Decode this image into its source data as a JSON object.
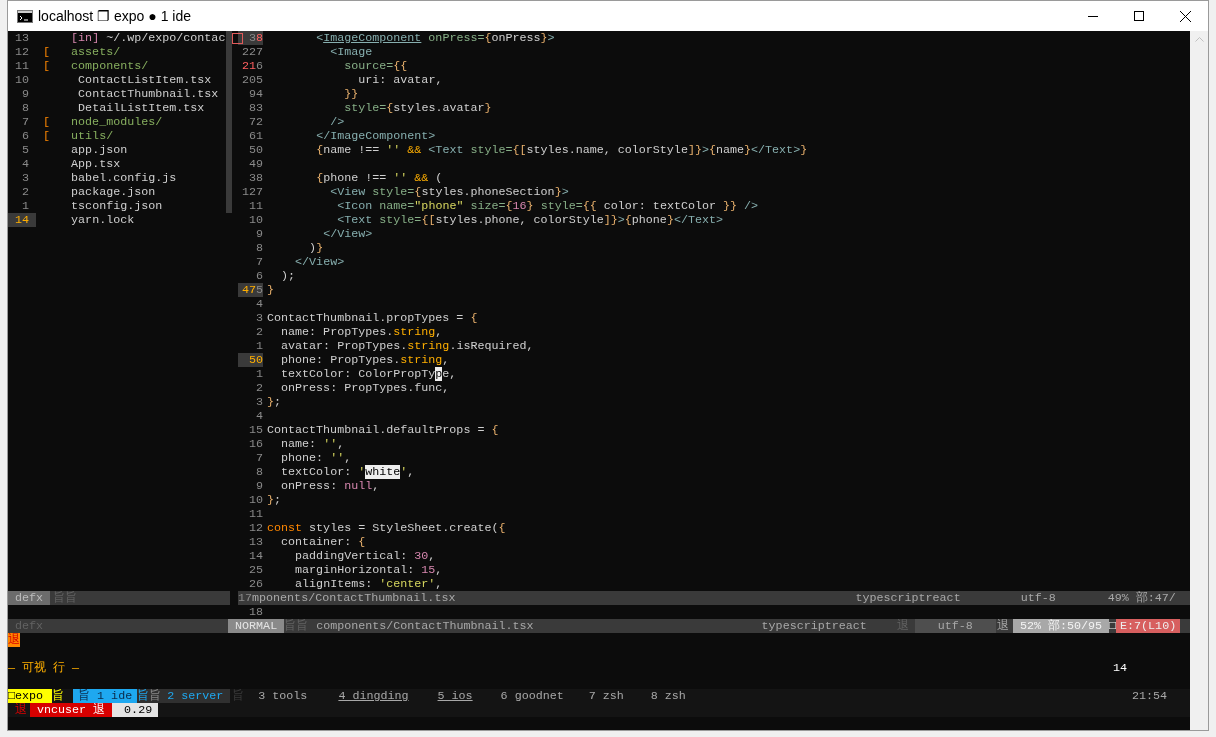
{
  "window": {
    "title": "localhost ❐ expo ● 1 ide"
  },
  "tree_pane": {
    "rows": [
      {
        "num": [
          {
            "text": "13",
            "kind": "d"
          }
        ],
        "hl": false,
        "text": [
          {
            "text": "     [in]",
            "kind": "m"
          },
          {
            "text": " ~/.wp/expo/contac",
            "kind": "p"
          }
        ]
      },
      {
        "num": [
          {
            "text": "12",
            "kind": "d"
          }
        ],
        "hl": false,
        "text": [
          {
            "text": " [",
            "kind": "br"
          },
          {
            "text": "   assets/",
            "kind": "g"
          }
        ]
      },
      {
        "num": [
          {
            "text": "11",
            "kind": "d"
          }
        ],
        "hl": false,
        "text": [
          {
            "text": " [",
            "kind": "br"
          },
          {
            "text": "   components/",
            "kind": "g"
          }
        ]
      },
      {
        "num": [
          {
            "text": "10",
            "kind": "d"
          }
        ],
        "hl": false,
        "text": [
          {
            "text": "      ContactListItem.tsx",
            "kind": "p"
          }
        ]
      },
      {
        "num": [
          {
            "text": "9",
            "kind": "d"
          }
        ],
        "hl": false,
        "text": [
          {
            "text": "      ContactThumbnail.tsx",
            "kind": "p"
          }
        ]
      },
      {
        "num": [
          {
            "text": "8",
            "kind": "d"
          }
        ],
        "hl": false,
        "text": [
          {
            "text": "      DetailListItem.tsx",
            "kind": "p"
          }
        ]
      },
      {
        "num": [
          {
            "text": "7",
            "kind": "d"
          }
        ],
        "hl": false,
        "text": [
          {
            "text": " [",
            "kind": "br"
          },
          {
            "text": "   node_modules/",
            "kind": "g"
          }
        ]
      },
      {
        "num": [
          {
            "text": "6",
            "kind": "d"
          }
        ],
        "hl": false,
        "text": [
          {
            "text": " [",
            "kind": "br"
          },
          {
            "text": "   utils/",
            "kind": "g"
          }
        ]
      },
      {
        "num": [
          {
            "text": "5",
            "kind": "d"
          }
        ],
        "hl": false,
        "text": [
          {
            "text": "     app.json",
            "kind": "p"
          }
        ]
      },
      {
        "num": [
          {
            "text": "4",
            "kind": "d"
          }
        ],
        "hl": false,
        "text": [
          {
            "text": "     App.tsx",
            "kind": "p"
          }
        ]
      },
      {
        "num": [
          {
            "text": "3",
            "kind": "d"
          }
        ],
        "hl": false,
        "text": [
          {
            "text": "     babel.config.js",
            "kind": "p"
          }
        ]
      },
      {
        "num": [
          {
            "text": "2",
            "kind": "d"
          }
        ],
        "hl": false,
        "text": [
          {
            "text": "     package.json",
            "kind": "p"
          }
        ]
      },
      {
        "num": [
          {
            "text": "1",
            "kind": "d"
          }
        ],
        "hl": false,
        "text": [
          {
            "text": "     tsconfig.json",
            "kind": "p"
          }
        ]
      },
      {
        "num": [
          {
            "text": "14",
            "kind": "o"
          }
        ],
        "hl": true,
        "text": [
          {
            "text": "     yarn.lock",
            "kind": "p"
          }
        ]
      }
    ]
  },
  "editor_pane": {
    "rows": [
      {
        "num": [
          {
            "text": "3",
            "kind": "d"
          },
          {
            "text": "8",
            "kind": "r"
          }
        ],
        "hl": true,
        "sign": true,
        "code": [
          {
            "text": "       <",
            "kind": "t"
          },
          {
            "text": "ImageComponent",
            "kind": "tu"
          },
          {
            "text": " onPress=",
            "kind": "a"
          },
          {
            "text": "{",
            "kind": "b"
          },
          {
            "text": "onPress",
            "kind": "p"
          },
          {
            "text": "}",
            "kind": "b"
          },
          {
            "text": ">",
            "kind": "t"
          }
        ]
      },
      {
        "num": [
          {
            "text": "227",
            "kind": "d"
          }
        ],
        "hl": false,
        "code": [
          {
            "text": "         <Image",
            "kind": "t"
          }
        ]
      },
      {
        "num": [
          {
            "text": "21",
            "kind": "r"
          },
          {
            "text": "6",
            "kind": "d"
          }
        ],
        "hl": false,
        "code": [
          {
            "text": "           source=",
            "kind": "a"
          },
          {
            "text": "{{",
            "kind": "b"
          }
        ]
      },
      {
        "num": [
          {
            "text": "205",
            "kind": "d"
          }
        ],
        "hl": false,
        "code": [
          {
            "text": "             uri: avatar,",
            "kind": "p"
          }
        ]
      },
      {
        "num": [
          {
            "text": "94",
            "kind": "d"
          }
        ],
        "hl": false,
        "code": [
          {
            "text": "           }}",
            "kind": "b"
          }
        ]
      },
      {
        "num": [
          {
            "text": "83",
            "kind": "d"
          }
        ],
        "hl": false,
        "code": [
          {
            "text": "           style=",
            "kind": "a"
          },
          {
            "text": "{",
            "kind": "b"
          },
          {
            "text": "styles.avatar",
            "kind": "p"
          },
          {
            "text": "}",
            "kind": "b"
          }
        ]
      },
      {
        "num": [
          {
            "text": "72",
            "kind": "d"
          }
        ],
        "hl": false,
        "code": [
          {
            "text": "         />",
            "kind": "t"
          }
        ]
      },
      {
        "num": [
          {
            "text": "61",
            "kind": "d"
          }
        ],
        "hl": false,
        "code": [
          {
            "text": "       </ImageComponent>",
            "kind": "t"
          }
        ]
      },
      {
        "num": [
          {
            "text": "50",
            "kind": "d"
          }
        ],
        "hl": false,
        "code": [
          {
            "text": "       {",
            "kind": "b"
          },
          {
            "text": "name !== ",
            "kind": "p"
          },
          {
            "text": "''",
            "kind": "s"
          },
          {
            "text": " &&",
            "kind": "o"
          },
          {
            "text": " <Text",
            "kind": "t"
          },
          {
            "text": " style=",
            "kind": "a"
          },
          {
            "text": "{[",
            "kind": "b"
          },
          {
            "text": "styles.name, colorStyle",
            "kind": "p"
          },
          {
            "text": "]}",
            "kind": "b"
          },
          {
            "text": ">",
            "kind": "t"
          },
          {
            "text": "{",
            "kind": "b"
          },
          {
            "text": "name",
            "kind": "p"
          },
          {
            "text": "}",
            "kind": "b"
          },
          {
            "text": "</Text>",
            "kind": "t"
          },
          {
            "text": "}",
            "kind": "b"
          }
        ]
      },
      {
        "num": [
          {
            "text": "49",
            "kind": "d"
          }
        ],
        "hl": false
      },
      {
        "num": [
          {
            "text": "38",
            "kind": "d"
          }
        ],
        "hl": false,
        "code": [
          {
            "text": "       {",
            "kind": "b"
          },
          {
            "text": "phone !== ",
            "kind": "p"
          },
          {
            "text": "''",
            "kind": "s"
          },
          {
            "text": " &&",
            "kind": "o"
          },
          {
            "text": " (",
            "kind": "p"
          }
        ]
      },
      {
        "num": [
          {
            "text": "127",
            "kind": "d"
          }
        ],
        "hl": false,
        "code": [
          {
            "text": "         <View",
            "kind": "t"
          },
          {
            "text": " style=",
            "kind": "a"
          },
          {
            "text": "{",
            "kind": "b"
          },
          {
            "text": "styles.phoneSection",
            "kind": "p"
          },
          {
            "text": "}",
            "kind": "b"
          },
          {
            "text": ">",
            "kind": "t"
          }
        ]
      },
      {
        "num": [
          {
            "text": "11",
            "kind": "d"
          }
        ],
        "hl": false,
        "code": [
          {
            "text": "          <Icon",
            "kind": "t"
          },
          {
            "text": " name=",
            "kind": "a"
          },
          {
            "text": "\"phone\"",
            "kind": "s"
          },
          {
            "text": " size=",
            "kind": "a"
          },
          {
            "text": "{",
            "kind": "b"
          },
          {
            "text": "16",
            "kind": "n"
          },
          {
            "text": "}",
            "kind": "b"
          },
          {
            "text": " style=",
            "kind": "a"
          },
          {
            "text": "{{",
            "kind": "b"
          },
          {
            "text": " color: textColor ",
            "kind": "p"
          },
          {
            "text": "}}",
            "kind": "b"
          },
          {
            "text": " />",
            "kind": "t"
          }
        ]
      },
      {
        "num": [
          {
            "text": "10",
            "kind": "d"
          }
        ],
        "hl": false,
        "code": [
          {
            "text": "          <Text",
            "kind": "t"
          },
          {
            "text": " style=",
            "kind": "a"
          },
          {
            "text": "{[",
            "kind": "b"
          },
          {
            "text": "styles.phone, colorStyle",
            "kind": "p"
          },
          {
            "text": "]}",
            "kind": "b"
          },
          {
            "text": ">",
            "kind": "t"
          },
          {
            "text": "{",
            "kind": "b"
          },
          {
            "text": "phone",
            "kind": "p"
          },
          {
            "text": "}",
            "kind": "b"
          },
          {
            "text": "</Text>",
            "kind": "t"
          }
        ]
      },
      {
        "num": [
          {
            "text": "9",
            "kind": "d"
          }
        ],
        "hl": false,
        "code": [
          {
            "text": "        </View>",
            "kind": "t"
          }
        ]
      },
      {
        "num": [
          {
            "text": "8",
            "kind": "d"
          }
        ],
        "hl": false,
        "code": [
          {
            "text": "      )",
            "kind": "p"
          },
          {
            "text": "}",
            "kind": "b"
          }
        ]
      },
      {
        "num": [
          {
            "text": "7",
            "kind": "d"
          }
        ],
        "hl": false,
        "code": [
          {
            "text": "    </View>",
            "kind": "t"
          }
        ]
      },
      {
        "num": [
          {
            "text": "6",
            "kind": "d"
          }
        ],
        "hl": false,
        "code": [
          {
            "text": "  );",
            "kind": "p"
          }
        ]
      },
      {
        "num": [
          {
            "text": "47",
            "kind": "o"
          },
          {
            "text": "5",
            "kind": "d"
          }
        ],
        "hl": true,
        "code": [
          {
            "text": "}",
            "kind": "b"
          }
        ]
      },
      {
        "num": [
          {
            "text": "4",
            "kind": "d"
          }
        ],
        "hl": false
      },
      {
        "num": [
          {
            "text": "3",
            "kind": "d"
          }
        ],
        "hl": false,
        "code": [
          {
            "text": "ContactThumbnail.propTypes = ",
            "kind": "p"
          },
          {
            "text": "{",
            "kind": "b"
          }
        ]
      },
      {
        "num": [
          {
            "text": "2",
            "kind": "d"
          }
        ],
        "hl": false,
        "code": [
          {
            "text": "  name: PropTypes.",
            "kind": "p"
          },
          {
            "text": "string",
            "kind": "y"
          },
          {
            "text": ",",
            "kind": "p"
          }
        ]
      },
      {
        "num": [
          {
            "text": "1",
            "kind": "d"
          }
        ],
        "hl": false,
        "code": [
          {
            "text": "  avatar: PropTypes.",
            "kind": "p"
          },
          {
            "text": "string",
            "kind": "y"
          },
          {
            "text": ".isRequired,",
            "kind": "p"
          }
        ]
      },
      {
        "num": [
          {
            "text": "50",
            "kind": "o"
          }
        ],
        "hl": true,
        "code": [
          {
            "text": "  phone: PropTypes.",
            "kind": "p"
          },
          {
            "text": "string",
            "kind": "y"
          },
          {
            "text": ",",
            "kind": "p"
          }
        ]
      },
      {
        "num": [
          {
            "text": "1",
            "kind": "d"
          }
        ],
        "hl": false,
        "code": [
          {
            "text": "  textColor: ColorPropTy",
            "kind": "p"
          },
          {
            "text": "p",
            "kind": "cur"
          },
          {
            "text": "e,",
            "kind": "p"
          }
        ]
      },
      {
        "num": [
          {
            "text": "2",
            "kind": "d"
          }
        ],
        "hl": false,
        "code": [
          {
            "text": "  onPress: PropTypes.func,",
            "kind": "p"
          }
        ]
      },
      {
        "num": [
          {
            "text": "3",
            "kind": "d"
          }
        ],
        "hl": false,
        "code": [
          {
            "text": "}",
            "kind": "b"
          },
          {
            "text": ";",
            "kind": "p"
          }
        ]
      },
      {
        "num": [
          {
            "text": "4",
            "kind": "d"
          }
        ],
        "hl": false
      },
      {
        "num": [
          {
            "text": "15",
            "kind": "d"
          }
        ],
        "hl": false,
        "code": [
          {
            "text": "ContactThumbnail.defaultProps = ",
            "kind": "p"
          },
          {
            "text": "{",
            "kind": "b"
          }
        ]
      },
      {
        "num": [
          {
            "text": "16",
            "kind": "d"
          }
        ],
        "hl": false,
        "code": [
          {
            "text": "  name: ",
            "kind": "p"
          },
          {
            "text": "''",
            "kind": "s"
          },
          {
            "text": ",",
            "kind": "p"
          }
        ]
      },
      {
        "num": [
          {
            "text": "7",
            "kind": "d"
          }
        ],
        "hl": false,
        "code": [
          {
            "text": "  phone: ",
            "kind": "p"
          },
          {
            "text": "''",
            "kind": "s"
          },
          {
            "text": ",",
            "kind": "p"
          }
        ]
      },
      {
        "num": [
          {
            "text": "8",
            "kind": "d"
          }
        ],
        "hl": false,
        "code": [
          {
            "text": "  textColor: ",
            "kind": "p"
          },
          {
            "text": "'",
            "kind": "s"
          },
          {
            "text": "white",
            "kind": "hl"
          },
          {
            "text": "'",
            "kind": "s"
          },
          {
            "text": ",",
            "kind": "p"
          }
        ]
      },
      {
        "num": [
          {
            "text": "9",
            "kind": "d"
          }
        ],
        "hl": false,
        "code": [
          {
            "text": "  onPress: ",
            "kind": "p"
          },
          {
            "text": "null",
            "kind": "n"
          },
          {
            "text": ",",
            "kind": "p"
          }
        ]
      },
      {
        "num": [
          {
            "text": "10",
            "kind": "d"
          }
        ],
        "hl": false,
        "code": [
          {
            "text": "}",
            "kind": "b"
          },
          {
            "text": ";",
            "kind": "p"
          }
        ]
      },
      {
        "num": [
          {
            "text": "11",
            "kind": "d"
          }
        ],
        "hl": false
      },
      {
        "num": [
          {
            "text": "12",
            "kind": "d"
          }
        ],
        "hl": false,
        "code": [
          {
            "text": "const",
            "kind": "k"
          },
          {
            "text": " styles = StyleSheet.create(",
            "kind": "p"
          },
          {
            "text": "{",
            "kind": "b"
          }
        ]
      },
      {
        "num": [
          {
            "text": "13",
            "kind": "d"
          }
        ],
        "hl": false,
        "code": [
          {
            "text": "  container: ",
            "kind": "p"
          },
          {
            "text": "{",
            "kind": "b"
          }
        ]
      },
      {
        "num": [
          {
            "text": "14",
            "kind": "d"
          }
        ],
        "hl": false,
        "code": [
          {
            "text": "    paddingVertical: ",
            "kind": "p"
          },
          {
            "text": "30",
            "kind": "n"
          },
          {
            "text": ",",
            "kind": "p"
          }
        ]
      },
      {
        "num": [
          {
            "text": "25",
            "kind": "d"
          }
        ],
        "hl": false,
        "code": [
          {
            "text": "    marginHorizontal: ",
            "kind": "p"
          },
          {
            "text": "15",
            "kind": "n"
          },
          {
            "text": ",",
            "kind": "p"
          }
        ]
      },
      {
        "num": [
          {
            "text": "26",
            "kind": "d"
          }
        ],
        "hl": false,
        "code": [
          {
            "text": "    alignItems: ",
            "kind": "p"
          },
          {
            "text": "'center'",
            "kind": "s"
          },
          {
            "text": ",",
            "kind": "p"
          }
        ]
      }
    ]
  },
  "tree_status": [
    {
      "text": "defx",
      "kind": "label"
    },
    {
      "text": "旨旨",
      "kind": "faint"
    }
  ],
  "editor_status": [
    {
      "text": "17",
      "kind": "num"
    },
    {
      "text": "mponents/ContactThumbnail.tsx",
      "kind": "text"
    },
    {
      "text": "typescriptreact",
      "kind": "text"
    },
    {
      "text": "utf-8",
      "kind": "text"
    },
    {
      "text": "49% 部:47/",
      "kind": "text"
    }
  ],
  "editor_extra_line": {
    "num": "18"
  },
  "status_line": [
    {
      "text": "defx",
      "kind": "faint"
    },
    {
      "text": "NORMAL",
      "kind": "mode"
    },
    {
      "text": "旨旨",
      "kind": "faint"
    },
    {
      "text": "components/ContactThumbnail.tsx",
      "kind": "text"
    },
    {
      "text": "typescriptreact",
      "kind": "text"
    },
    {
      "text": "退",
      "kind": "faint"
    },
    {
      "text": "utf-8",
      "kind": "panel"
    },
    {
      "text": "退",
      "kind": "text"
    },
    {
      "text": "52% 部:50/95",
      "kind": "light"
    },
    {
      "text": "□",
      "kind": "box"
    },
    {
      "text": "E:7(L10)",
      "kind": "error"
    }
  ],
  "message_line": {
    "text": "退"
  },
  "mode_line": {
    "text": "— 可视 行 —",
    "count": "14"
  },
  "tmux_bar": {
    "segments": [
      {
        "text": "□expo",
        "kind": "session"
      },
      {
        "text": "旨",
        "kind": "session-sep"
      },
      {
        "text": "旨 1 ide",
        "kind": "current"
      },
      {
        "text": "旨",
        "kind": "current-sep"
      },
      {
        "text": "旨",
        "kind": "last-sep"
      },
      {
        "text": "2 server",
        "kind": "last"
      },
      {
        "text": "旨",
        "kind": "sep"
      },
      {
        "text": "3 tools",
        "kind": "window"
      },
      {
        "text": "4 dingding",
        "kind": "activity"
      },
      {
        "text": "5 ios",
        "kind": "activity"
      },
      {
        "text": "6 goodnet",
        "kind": "window"
      },
      {
        "text": "7 zsh",
        "kind": "window"
      },
      {
        "text": "8 zsh",
        "kind": "window"
      }
    ],
    "clock": "21:54"
  },
  "tmux_load": [
    {
      "text": "退",
      "kind": "alert"
    },
    {
      "text": "vncuser 退",
      "kind": "user"
    },
    {
      "text": "0.29",
      "kind": "load"
    }
  ]
}
